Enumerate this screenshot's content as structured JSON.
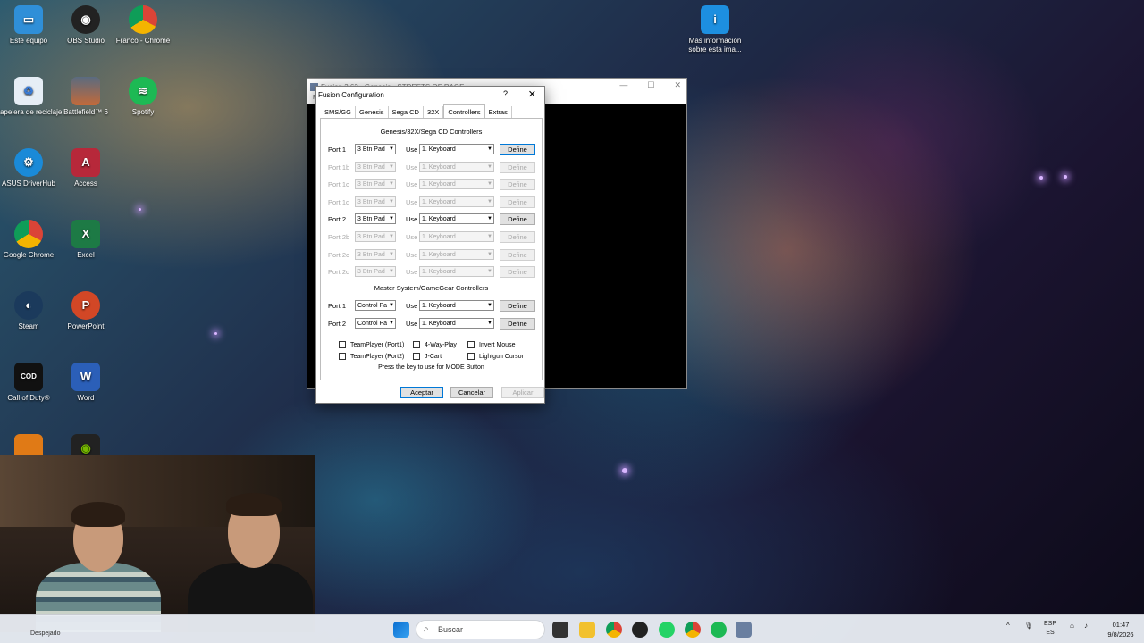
{
  "desktop": {
    "icons": [
      {
        "label": "Este equipo",
        "icon": "monitor-icon"
      },
      {
        "label": "OBS Studio",
        "icon": "obs-icon"
      },
      {
        "label": "Franco - Chrome",
        "icon": "chrome-icon"
      },
      {
        "label": "Más información sobre esta ima...",
        "icon": "info-icon"
      },
      {
        "label": "Papelera de reciclaje",
        "icon": "recycle-bin-icon"
      },
      {
        "label": "Battlefield™ 6",
        "icon": "battlefield-icon"
      },
      {
        "label": "Spotify",
        "icon": "spotify-icon"
      },
      {
        "label": "ASUS DriverHub",
        "icon": "asus-icon"
      },
      {
        "label": "Access",
        "icon": "access-icon"
      },
      {
        "label": "Google Chrome",
        "icon": "chrome-icon"
      },
      {
        "label": "Excel",
        "icon": "excel-icon"
      },
      {
        "label": "Steam",
        "icon": "steam-icon"
      },
      {
        "label": "PowerPoint",
        "icon": "powerpoint-icon"
      },
      {
        "label": "Call of Duty®",
        "icon": "cod-icon"
      },
      {
        "label": "Word",
        "icon": "word-icon"
      }
    ]
  },
  "emulator": {
    "title": "Fusion 3.63 - Genesis - STREETS OF RAGE",
    "menu": "Fi"
  },
  "dialog": {
    "title": "Fusion Configuration",
    "help": "?",
    "close": "✕",
    "tabs": [
      "SMS/GG",
      "Genesis",
      "Sega CD",
      "32X",
      "Controllers",
      "Extras"
    ],
    "active_tab": "Controllers",
    "genesis_section": "Genesis/32X/Sega CD Controllers",
    "genesis_ports": [
      {
        "port": "Port 1",
        "pad": "3 Btn Pad",
        "use": "Use",
        "device": "1. Keyboard",
        "button": "Define",
        "enabled": true,
        "focused": true
      },
      {
        "port": "Port 1b",
        "pad": "3 Btn Pad",
        "use": "Use",
        "device": "1. Keyboard",
        "button": "Define",
        "enabled": false
      },
      {
        "port": "Port 1c",
        "pad": "3 Btn Pad",
        "use": "Use",
        "device": "1. Keyboard",
        "button": "Define",
        "enabled": false
      },
      {
        "port": "Port 1d",
        "pad": "3 Btn Pad",
        "use": "Use",
        "device": "1. Keyboard",
        "button": "Define",
        "enabled": false
      },
      {
        "port": "Port 2",
        "pad": "3 Btn Pad",
        "use": "Use",
        "device": "1. Keyboard",
        "button": "Define",
        "enabled": true
      },
      {
        "port": "Port 2b",
        "pad": "3 Btn Pad",
        "use": "Use",
        "device": "1. Keyboard",
        "button": "Define",
        "enabled": false
      },
      {
        "port": "Port 2c",
        "pad": "3 Btn Pad",
        "use": "Use",
        "device": "1. Keyboard",
        "button": "Define",
        "enabled": false
      },
      {
        "port": "Port 2d",
        "pad": "3 Btn Pad",
        "use": "Use",
        "device": "1. Keyboard",
        "button": "Define",
        "enabled": false
      }
    ],
    "sms_section": "Master System/GameGear Controllers",
    "sms_ports": [
      {
        "port": "Port 1",
        "pad": "Control Pa",
        "use": "Use",
        "device": "1. Keyboard",
        "button": "Define"
      },
      {
        "port": "Port 2",
        "pad": "Control Pa",
        "use": "Use",
        "device": "1. Keyboard",
        "button": "Define"
      }
    ],
    "checkboxes": [
      "TeamPlayer (Port1)",
      "4-Way-Play",
      "Invert Mouse",
      "TeamPlayer (Port2)",
      "J-Cart",
      "Lightgun Cursor"
    ],
    "hint": "Press the key to use for MODE Button",
    "ok": "Aceptar",
    "cancel": "Cancelar",
    "apply": "Aplicar"
  },
  "webcam": {
    "status": "Despejado"
  },
  "taskbar": {
    "search_placeholder": "Buscar",
    "lang_top": "ESP",
    "lang_bottom": "ES",
    "time": "01:47",
    "date": "9/8/2026"
  }
}
